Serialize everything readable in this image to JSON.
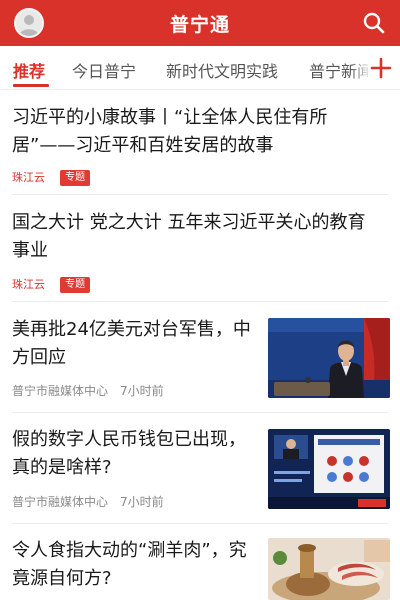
{
  "app": {
    "title": "普宁通"
  },
  "tabs": [
    {
      "label": "推荐",
      "active": true
    },
    {
      "label": "今日普宁",
      "active": false
    },
    {
      "label": "新时代文明实践",
      "active": false
    },
    {
      "label": "普宁新闻",
      "active": false
    }
  ],
  "articles": [
    {
      "title_lines": [
        "习近平的小康故事丨“让全体人民住有所",
        "居”——习近平和百姓安居的故事"
      ],
      "source": "珠江云",
      "badge": "专题",
      "thumbnail": null
    },
    {
      "title_lines": [
        "国之大计 党之大计 五年来习近平关心的教育",
        "事业"
      ],
      "source": "珠江云",
      "badge": "专题",
      "thumbnail": null
    },
    {
      "title_lines": [
        "美再批24亿美元对台军售，中",
        "方回应"
      ],
      "source": "普宁市融媒体中心",
      "time": "7小时前",
      "thumbnail": "spokesperson-photo"
    },
    {
      "title_lines": [
        "假的数字人民币钱包已出现，",
        "真的是啥样?"
      ],
      "source": "普宁市融媒体中心",
      "time": "7小时前",
      "thumbnail": "video-conference-photo"
    },
    {
      "title_lines": [
        "令人食指大动的“涮羊肉”，究",
        "竟源自何方?"
      ],
      "thumbnail": "hotpot-photo"
    }
  ],
  "icons": {
    "avatar": "user-avatar-icon",
    "search": "search-icon",
    "add": "plus-icon"
  },
  "colors": {
    "brand": "#d9322b",
    "badge": "#e03a32",
    "meta": "#8a8a8a"
  }
}
